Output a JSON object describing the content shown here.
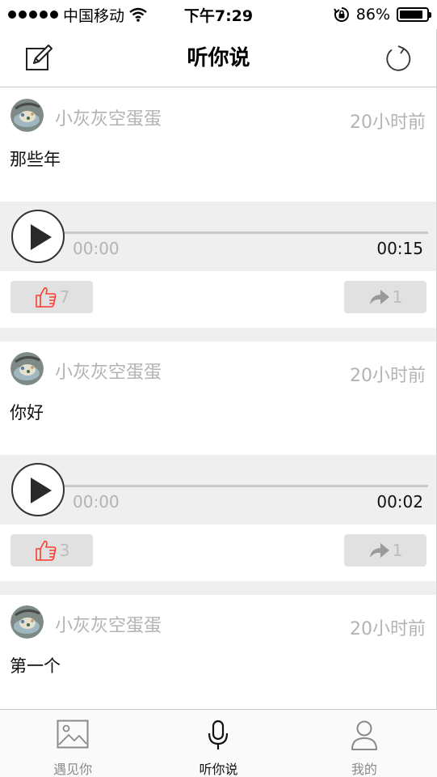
{
  "status_bar": {
    "carrier": "中国移动",
    "time": "下午7:29",
    "battery_percent": "86%",
    "battery_level": 0.86
  },
  "nav": {
    "title": "听你说",
    "left_icon": "compose-icon",
    "right_icon": "refresh-icon"
  },
  "posts": [
    {
      "author": "小灰灰空蛋蛋",
      "time": "20小时前",
      "text": "那些年",
      "current_time": "00:00",
      "duration": "00:15",
      "progress": 0,
      "likes": "7",
      "shares": "1"
    },
    {
      "author": "小灰灰空蛋蛋",
      "time": "20小时前",
      "text": "你好",
      "current_time": "00:00",
      "duration": "00:02",
      "progress": 0,
      "likes": "3",
      "shares": "1"
    },
    {
      "author": "小灰灰空蛋蛋",
      "time": "20小时前",
      "text": "第一个"
    }
  ],
  "tabs": [
    {
      "label": "遇见你",
      "icon": "image-icon",
      "active": false
    },
    {
      "label": "听你说",
      "icon": "microphone-icon",
      "active": true
    },
    {
      "label": "我的",
      "icon": "person-icon",
      "active": false
    }
  ],
  "colors": {
    "like_icon": "#ff3b30",
    "muted_text": "#b3b3b3",
    "panel_bg": "#efefef"
  }
}
